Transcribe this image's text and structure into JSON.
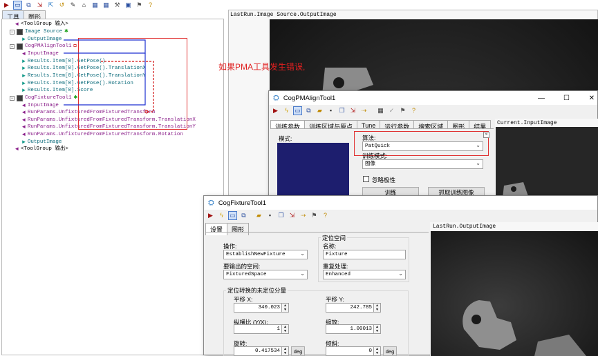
{
  "main_toolbar": {
    "icons": [
      "run-icon",
      "image-icon",
      "display-icon",
      "import-icon",
      "export-icon",
      "reset-icon",
      "link-icon",
      "edit-icon",
      "grid-icon",
      "grid2-icon",
      "tools-icon",
      "image2-icon",
      "location-icon",
      "help-icon"
    ]
  },
  "left_tabs": [
    "工具",
    "图形"
  ],
  "tree": [
    {
      "label": "<ToolGroup 输入>",
      "color": "#000000",
      "arrow": "◄",
      "arrow_color": "#8a1f8a"
    },
    {
      "label": "Image Source",
      "color": "#0a6a7a",
      "arrow": "",
      "arrow_color": ""
    },
    {
      "label": "OutputImage",
      "color": "#0a6a7a",
      "arrow": "►",
      "arrow_color": "#139a8a"
    },
    {
      "label": "CogPMAlignTool1",
      "color": "#8a1f8a",
      "arrow": "",
      "arrow_color": ""
    },
    {
      "label": "InputImage",
      "color": "#8a1f8a",
      "arrow": "◄",
      "arrow_color": "#8a1f8a"
    },
    {
      "label": "Results.Item[0].GetPose()",
      "color": "#0a6a7a",
      "arrow": "►",
      "arrow_color": "#139a8a"
    },
    {
      "label": "Results.Item[0].GetPose().TranslationX",
      "color": "#0a6a7a",
      "arrow": "►",
      "arrow_color": "#139a8a"
    },
    {
      "label": "Results.Item[0].GetPose().TranslationY",
      "color": "#0a6a7a",
      "arrow": "►",
      "arrow_color": "#139a8a"
    },
    {
      "label": "Results.Item[0].GetPose().Rotation",
      "color": "#0a6a7a",
      "arrow": "►",
      "arrow_color": "#139a8a"
    },
    {
      "label": "Results.Item[0].Score",
      "color": "#0a6a7a",
      "arrow": "►",
      "arrow_color": "#139a8a"
    },
    {
      "label": "CogFixtureTool1",
      "color": "#8a1f8a",
      "arrow": "",
      "arrow_color": ""
    },
    {
      "label": "InputImage",
      "color": "#8a1f8a",
      "arrow": "◄",
      "arrow_color": "#8a1f8a"
    },
    {
      "label": "RunParams.UnfixturedFromFixturedTransform",
      "color": "#8a1f8a",
      "arrow": "◄",
      "arrow_color": "#8a1f8a"
    },
    {
      "label": "RunParams.UnfixturedFromFixturedTransform.TranslationX",
      "color": "#8a1f8a",
      "arrow": "◄",
      "arrow_color": "#8a1f8a"
    },
    {
      "label": "RunParams.UnfixturedFromFixturedTransform.TranslationY",
      "color": "#8a1f8a",
      "arrow": "◄",
      "arrow_color": "#8a1f8a"
    },
    {
      "label": "RunParams.UnfixturedFromFixturedTransform.Rotation",
      "color": "#8a1f8a",
      "arrow": "◄",
      "arrow_color": "#8a1f8a"
    },
    {
      "label": "OutputImage",
      "color": "#0a6a7a",
      "arrow": "►",
      "arrow_color": "#139a8a"
    },
    {
      "label": "<ToolGroup 输出>",
      "color": "#000000",
      "arrow": "◄",
      "arrow_color": "#8a1f8a"
    }
  ],
  "main_image_title": "LastRun.Image Source.OutputImage",
  "annotation": "如果PMA工具发生错误,",
  "pma_window": {
    "title": "CogPMAlignTool1",
    "tabs": [
      "训练参数",
      "训练区域与原点",
      "Tune",
      "运行参数",
      "搜索区域",
      "图形",
      "结果"
    ],
    "model_label": "模式:",
    "algorithm_label": "算法:",
    "algorithm_value": "PatQuick",
    "train_mode_label": "训练模式:",
    "train_mode_value": "图像",
    "ignore_polarity_label": "忽略极性",
    "train_button": "训练",
    "grab_button": "抓取训练图像",
    "image_title": "Current.InputImage",
    "window_controls": [
      "—",
      "☐",
      "✕"
    ]
  },
  "fixture_window": {
    "title": "CogFixtureTool1",
    "tabs": [
      "设置",
      "图形"
    ],
    "operation_label": "操作:",
    "operation_value": "EstablishNewFixture",
    "fixture_space_group": "定位空间",
    "name_label": "名称:",
    "name_value": "Fixture",
    "output_space_label": "要输出的空间:",
    "output_space_value": "FixturedSpace",
    "resample_label": "重复处理:",
    "resample_value": "Enhanced",
    "transform_group": "定位转换的未定位分量",
    "translation_x_label": "平移 X:",
    "translation_x_value": "340.023",
    "translation_y_label": "平移 Y:",
    "translation_y_value": "242.785",
    "aspect_label": "纵横比 (Y/X):",
    "aspect_value": "1",
    "scale_label": "缩放:",
    "scale_value": "1.00013",
    "rotation_label": "旋转:",
    "rotation_value": "0.417534",
    "skew_label": "倾斜:",
    "skew_value": "0",
    "deg_unit": "deg",
    "image_title": "LastRun.OutputImage"
  }
}
